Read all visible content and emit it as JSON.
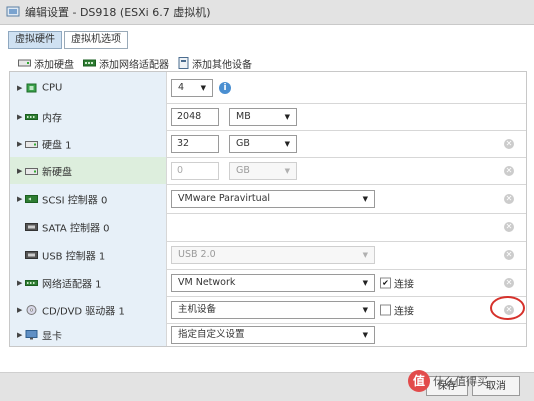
{
  "window": {
    "title": "编辑设置 - DS918 (ESXi 6.7 虚拟机)"
  },
  "tabs": [
    {
      "label": "虚拟硬件",
      "active": true
    },
    {
      "label": "虚拟机选项",
      "active": false
    }
  ],
  "toolbar": {
    "add_disk": "添加硬盘",
    "add_nic": "添加网络适配器",
    "add_other": "添加其他设备"
  },
  "rows": {
    "cpu": {
      "label": "CPU",
      "value": "4",
      "info_glyph": "i"
    },
    "memory": {
      "label": "内存",
      "value": "2048",
      "unit": "MB"
    },
    "disk1": {
      "label": "硬盘 1",
      "value": "32",
      "unit": "GB"
    },
    "newdisk": {
      "label": "新硬盘",
      "value": "0",
      "unit": "GB"
    },
    "scsi": {
      "label": "SCSI 控制器 0",
      "value": "VMware Paravirtual"
    },
    "sata": {
      "label": "SATA 控制器 0"
    },
    "usb": {
      "label": "USB 控制器 1",
      "value": "USB 2.0"
    },
    "nic": {
      "label": "网络适配器 1",
      "value": "VM Network",
      "connect_label": "连接",
      "connected": true
    },
    "cdrom": {
      "label": "CD/DVD 驱动器 1",
      "value": "主机设备",
      "connect_label": "连接",
      "connected": false
    },
    "video": {
      "label": "显卡",
      "value": "指定自定义设置"
    }
  },
  "footer": {
    "save": "保存",
    "cancel": "取消"
  },
  "watermark": {
    "logo_glyph": "值",
    "text": "什么值得买"
  },
  "colors": {
    "accent": "#4a8fd1",
    "highlight": "#d6312b",
    "row_bg": "#e7f0f8",
    "new_row_bg": "#ddeedd"
  }
}
